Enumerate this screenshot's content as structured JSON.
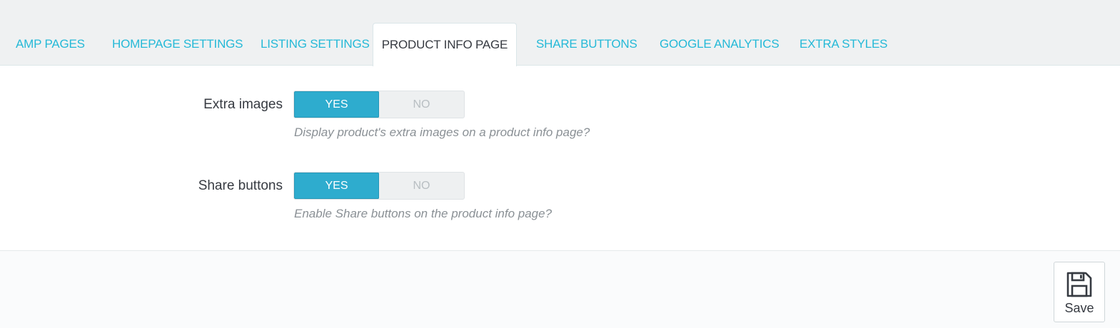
{
  "tabs": [
    {
      "label": "AMP PAGES",
      "active": false
    },
    {
      "label": "HOMEPAGE SETTINGS",
      "active": false
    },
    {
      "label": "LISTING SETTINGS",
      "active": false
    },
    {
      "label": "PRODUCT INFO PAGE",
      "active": true
    },
    {
      "label": "SHARE BUTTONS",
      "active": false
    },
    {
      "label": "GOOGLE ANALYTICS",
      "active": false
    },
    {
      "label": "EXTRA STYLES",
      "active": false
    }
  ],
  "settings": {
    "extra_images": {
      "label": "Extra images",
      "yes": "YES",
      "no": "NO",
      "selected": "YES",
      "help": "Display product's extra images on a product info page?"
    },
    "share_buttons": {
      "label": "Share buttons",
      "yes": "YES",
      "no": "NO",
      "selected": "YES",
      "help": "Enable Share buttons on the product info page?"
    }
  },
  "footer": {
    "save_label": "Save",
    "save_icon": "floppy-disk-icon"
  },
  "colors": {
    "accent": "#25b9d7",
    "switch_on": "#2eacce",
    "text": "#363a41",
    "help_text": "#8a9095"
  }
}
